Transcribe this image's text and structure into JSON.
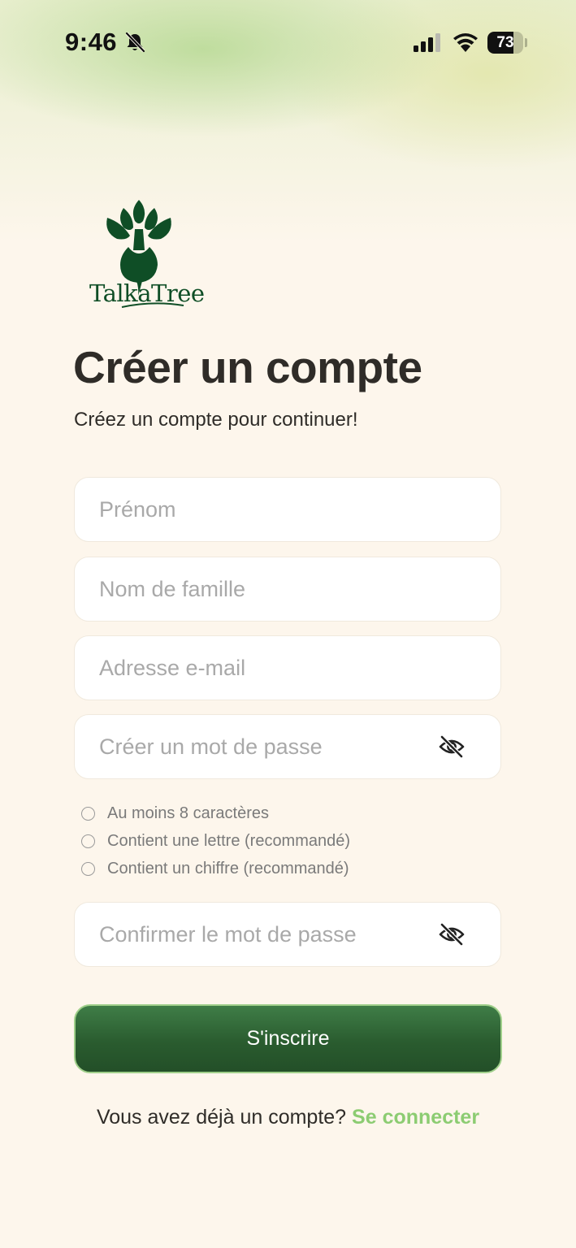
{
  "status_bar": {
    "time": "9:46",
    "battery_percent": 73,
    "battery_label": "73",
    "icons": [
      "bell-slash-icon",
      "cellular-signal-icon",
      "wifi-icon",
      "battery-icon"
    ]
  },
  "brand": {
    "name": "TalkaTree",
    "logo_icon": "tree-beet-logo-icon",
    "color": "#0f4e26"
  },
  "page": {
    "title": "Créer un compte",
    "subtitle": "Créez un compte pour continuer!"
  },
  "form": {
    "first_name": {
      "placeholder": "Prénom",
      "value": ""
    },
    "last_name": {
      "placeholder": "Nom de famille",
      "value": ""
    },
    "email": {
      "placeholder": "Adresse e-mail",
      "value": ""
    },
    "password": {
      "placeholder": "Créer un mot de passe",
      "value": "",
      "toggle_icon": "eye-off-icon"
    },
    "confirm_password": {
      "placeholder": "Confirmer le mot de passe",
      "value": "",
      "toggle_icon": "eye-off-icon"
    },
    "requirements": [
      {
        "label": "Au moins 8 caractères",
        "met": false
      },
      {
        "label": "Contient une lettre (recommandé)",
        "met": false
      },
      {
        "label": "Contient un chiffre (recommandé)",
        "met": false
      }
    ]
  },
  "actions": {
    "signup_label": "S'inscrire",
    "login_prompt": "Vous avez déjà un compte?",
    "login_link": "Se connecter"
  },
  "colors": {
    "background": "#fdf6ec",
    "primary_button": "#2a5c2f",
    "button_border": "#9fcf8a",
    "link": "#8ccc72"
  }
}
